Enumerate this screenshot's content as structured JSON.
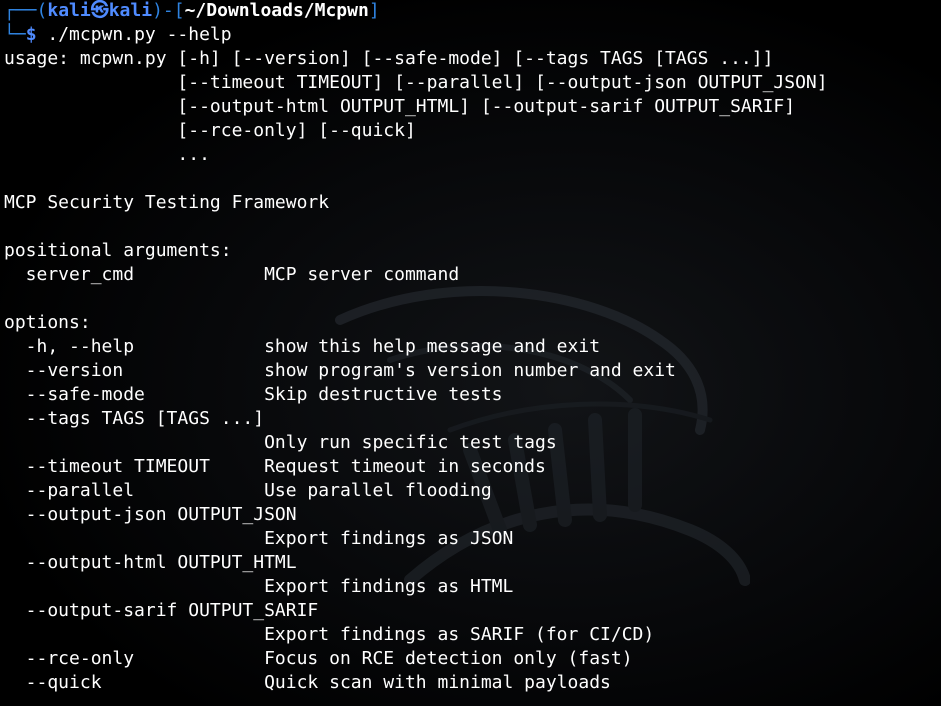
{
  "prompt": {
    "corner_top": "┌──(",
    "user": "kali",
    "at_symbol": "㉿",
    "host": "kali",
    "close_paren": ")-[",
    "path": "~/Downloads/Mcpwn",
    "close_bracket": "]",
    "corner_bottom": "└─",
    "dollar": "$",
    "command": " ./mcpwn.py --help"
  },
  "output_lines": [
    "usage: mcpwn.py [-h] [--version] [--safe-mode] [--tags TAGS [TAGS ...]]",
    "                [--timeout TIMEOUT] [--parallel] [--output-json OUTPUT_JSON]",
    "                [--output-html OUTPUT_HTML] [--output-sarif OUTPUT_SARIF]",
    "                [--rce-only] [--quick]",
    "                ...",
    "",
    "MCP Security Testing Framework",
    "",
    "positional arguments:",
    "  server_cmd            MCP server command",
    "",
    "options:",
    "  -h, --help            show this help message and exit",
    "  --version             show program's version number and exit",
    "  --safe-mode           Skip destructive tests",
    "  --tags TAGS [TAGS ...]",
    "                        Only run specific test tags",
    "  --timeout TIMEOUT     Request timeout in seconds",
    "  --parallel            Use parallel flooding",
    "  --output-json OUTPUT_JSON",
    "                        Export findings as JSON",
    "  --output-html OUTPUT_HTML",
    "                        Export findings as HTML",
    "  --output-sarif OUTPUT_SARIF",
    "                        Export findings as SARIF (for CI/CD)",
    "  --rce-only            Focus on RCE detection only (fast)",
    "  --quick               Quick scan with minimal payloads"
  ],
  "colors": {
    "background": "#000000",
    "prompt_frame": "#2f83e0",
    "prompt_user": "#4f8bff",
    "text": "#ffffff"
  },
  "icons": {
    "watermark": "kali-dragon-watermark"
  }
}
